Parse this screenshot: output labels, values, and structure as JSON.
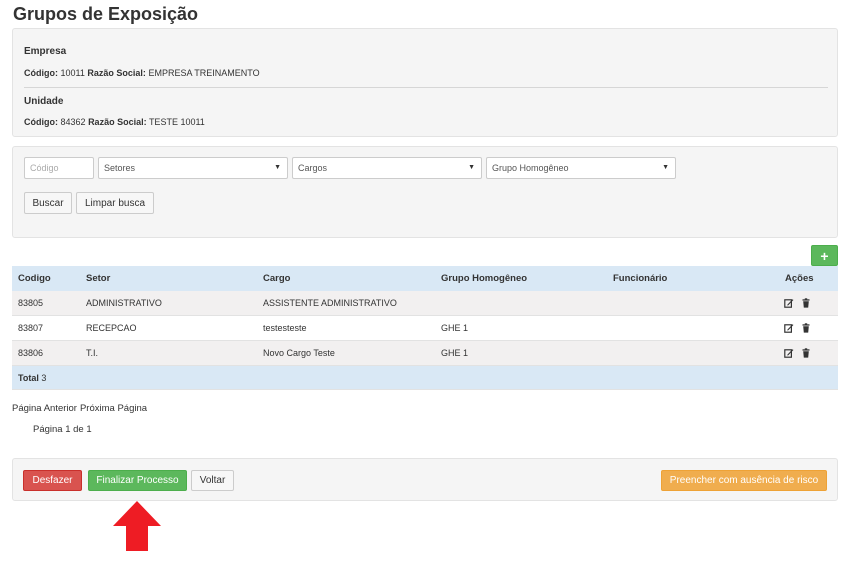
{
  "page": {
    "title": "Grupos de Exposição"
  },
  "empresa": {
    "heading": "Empresa",
    "codigo_label": "Código:",
    "codigo": "10011",
    "razao_label": "Razão Social:",
    "razao": "EMPRESA TREINAMENTO"
  },
  "unidade": {
    "heading": "Unidade",
    "codigo_label": "Código:",
    "codigo": "84362",
    "razao_label": "Razão Social:",
    "razao": "TESTE 10011"
  },
  "filters": {
    "codigo_placeholder": "Código",
    "setores": "Setores",
    "cargos": "Cargos",
    "grupo": "Grupo Homogêneo",
    "buscar": "Buscar",
    "limpar": "Limpar busca"
  },
  "add_button": "+",
  "table": {
    "headers": [
      "Codigo",
      "Setor",
      "Cargo",
      "Grupo Homogêneo",
      "Funcionário",
      "Ações"
    ],
    "rows": [
      [
        "83805",
        "ADMINISTRATIVO",
        "ASSISTENTE ADMINISTRATIVO",
        "",
        ""
      ],
      [
        "83807",
        "RECEPCAO",
        "testesteste",
        "GHE 1",
        ""
      ],
      [
        "83806",
        "T.I.",
        "Novo Cargo Teste",
        "GHE 1",
        ""
      ]
    ],
    "total_label": "Total",
    "total_value": "3"
  },
  "pagination": {
    "prev": "Página Anterior",
    "next": "Próxima Página",
    "info": "Página 1 de 1"
  },
  "actions": {
    "desfazer": "Desfazer",
    "finalizar": "Finalizar Processo",
    "voltar": "Voltar",
    "preencher": "Preencher com ausência de risco"
  },
  "colors": {
    "primary_green": "#5cb85c",
    "danger_red": "#d9534f",
    "warning_orange": "#f0ad4e",
    "table_header": "#d9e8f5",
    "arrow_red": "#ee1c24"
  },
  "icons": [
    "plus-icon",
    "edit-icon",
    "trash-icon",
    "caret-down-icon",
    "arrow-up-icon"
  ]
}
